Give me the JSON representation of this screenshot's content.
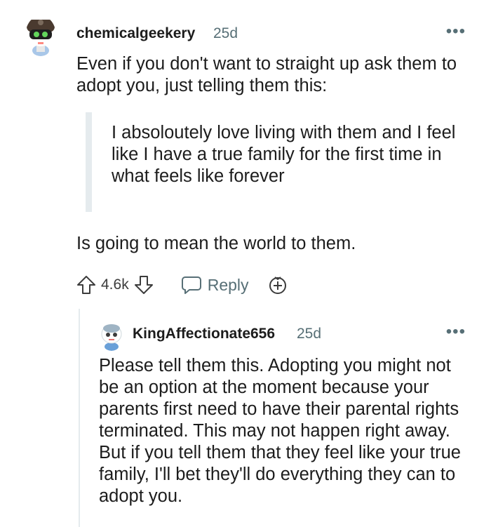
{
  "comment": {
    "username": "chemicalgeekery",
    "age": "25d",
    "more": "•••",
    "text_intro": "Even if you don't want to straight up ask them to adopt you, just telling them this:",
    "quote": "I absoloutely love living with them and I feel like I have a true family for the first time in what feels like forever",
    "text_outro": "Is going to mean the world to them.",
    "score": "4.6k",
    "reply_label": "Reply"
  },
  "reply": {
    "username": "KingAffectionate656",
    "age": "25d",
    "more": "•••",
    "text": "Please tell them this. Adopting you might not be an option at the moment because your parents first need to have their parental rights terminated. This may not happen right away. But if you tell them that they feel like your true family, I'll bet they'll do everything they can to adopt you."
  },
  "colors": {
    "text": "#1c1c1c",
    "meta": "#576f76",
    "quote_bar": "#e5ebee",
    "thread_line": "#e5ebee"
  }
}
